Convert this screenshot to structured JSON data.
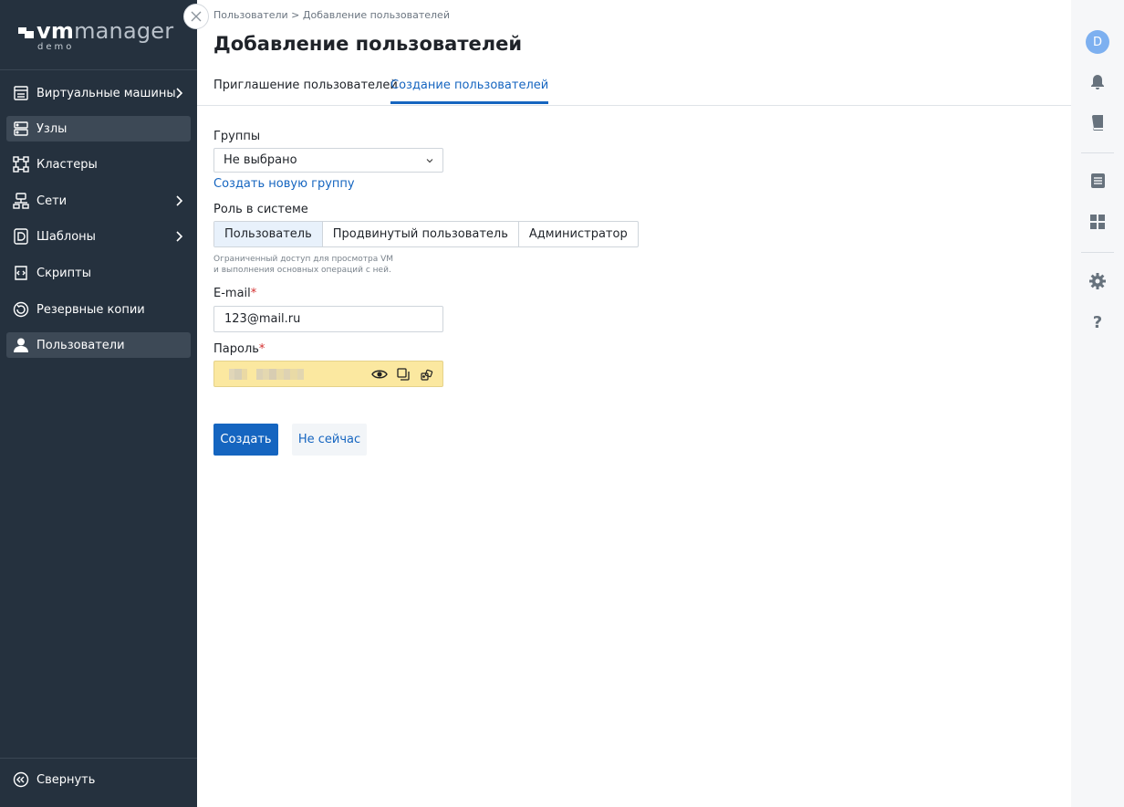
{
  "brand": {
    "name_bold": "vm",
    "name_rest": "manager",
    "sub": "demo"
  },
  "sidebar": {
    "items": [
      {
        "label": "Виртуальные машины",
        "icon": "vm-icon",
        "has_chevron": true,
        "active": false
      },
      {
        "label": "Узлы",
        "icon": "nodes-icon",
        "has_chevron": false,
        "active": true
      },
      {
        "label": "Кластеры",
        "icon": "clusters-icon",
        "has_chevron": false,
        "active": false
      },
      {
        "label": "Сети",
        "icon": "network-icon",
        "has_chevron": true,
        "active": false
      },
      {
        "label": "Шаблоны",
        "icon": "templates-icon",
        "has_chevron": true,
        "active": false
      },
      {
        "label": "Скрипты",
        "icon": "scripts-icon",
        "has_chevron": false,
        "active": false
      },
      {
        "label": "Резервные копии",
        "icon": "backup-icon",
        "has_chevron": false,
        "active": false
      },
      {
        "label": "Пользователи",
        "icon": "user-icon",
        "has_chevron": false,
        "active": true
      }
    ],
    "collapse_label": "Свернуть"
  },
  "header": {
    "breadcrumb": "Пользователи > Добавление пользователей",
    "title": "Добавление пользователей"
  },
  "tabs": [
    {
      "label": "Приглашение пользователей",
      "active": false
    },
    {
      "label": "Создание пользователей",
      "active": true
    }
  ],
  "form": {
    "groups_label": "Группы",
    "groups_value": "Не выбрано",
    "create_group_link": "Создать новую группу",
    "role_label": "Роль в системе",
    "roles": [
      "Пользователь",
      "Продвинутый пользователь",
      "Администратор"
    ],
    "selected_role": "Пользователь",
    "role_hint_line1": "Ограниченный доступ для просмотра VM",
    "role_hint_line2": "и выполнения основных операций с ней.",
    "email_label": "E-mail",
    "email_value": "123@mail.ru",
    "password_label": "Пароль",
    "required_mark": "*"
  },
  "actions": {
    "create": "Создать",
    "later": "Не сейчас"
  },
  "rail": {
    "avatar_letter": "D"
  },
  "colors": {
    "sidebar_bg": "#25313e",
    "accent": "#1565c0",
    "password_bg": "#fbe8a0",
    "avatar_bg": "#7db0f0"
  }
}
